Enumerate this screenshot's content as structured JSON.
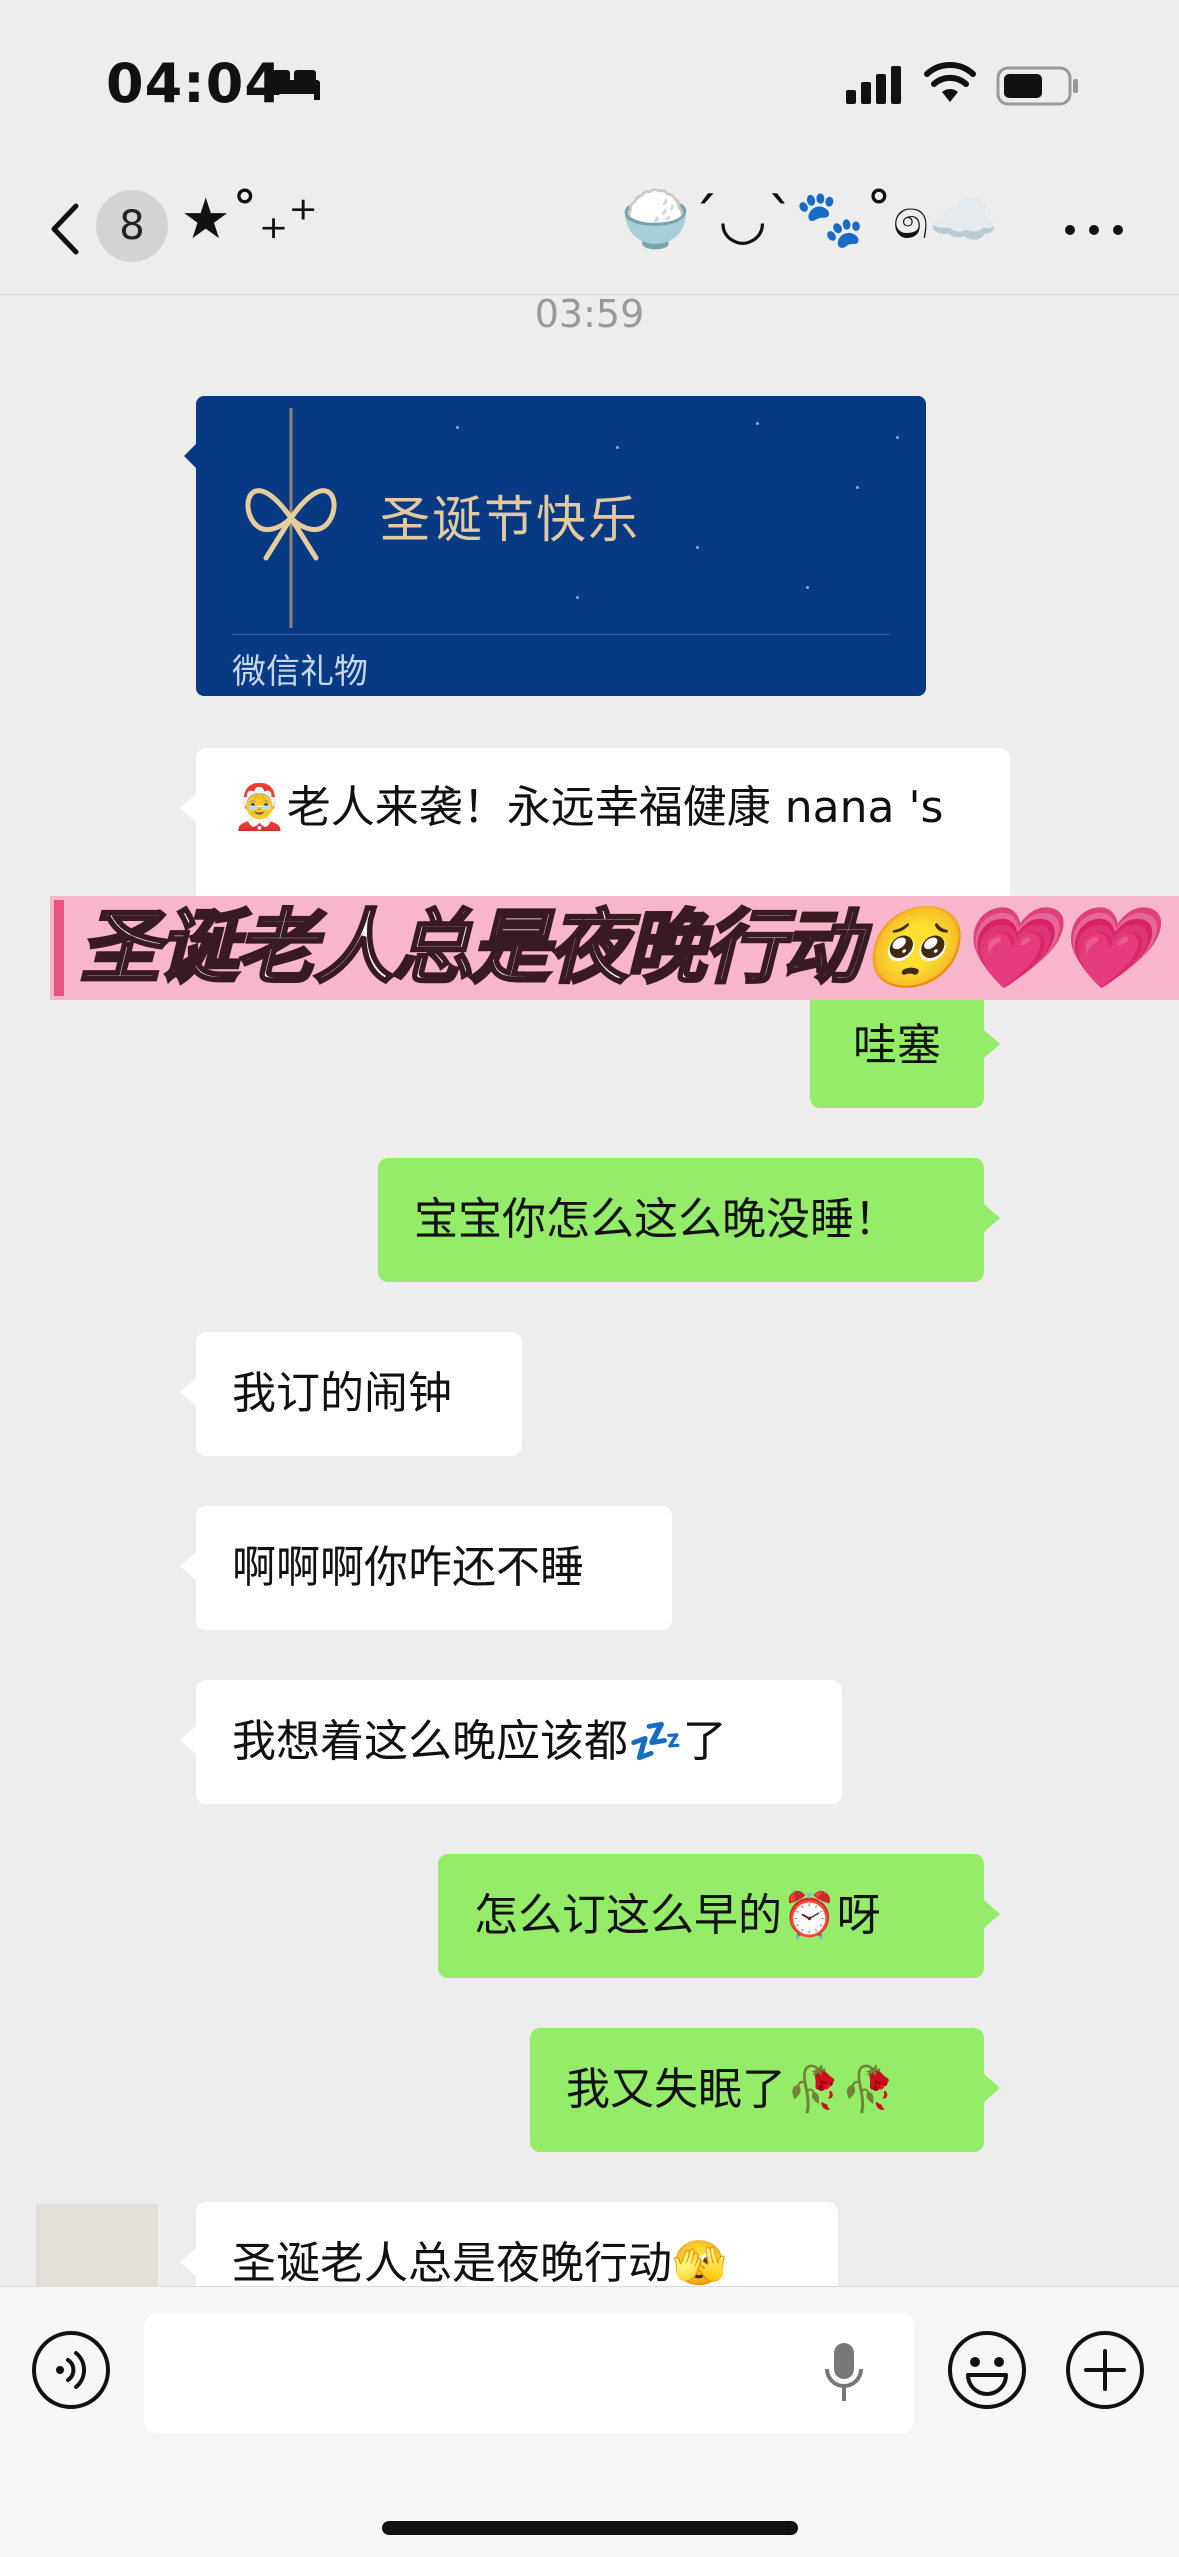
{
  "status_bar": {
    "time": "04:04"
  },
  "nav": {
    "unread_count": "8",
    "title": "★˚₊⁺                 🍚´◡`🐾˚෧☁️"
  },
  "chat": {
    "timestamp": "03:59",
    "gift_card": {
      "title": "圣诞节快乐",
      "footer": "微信礼物"
    },
    "messages": [
      {
        "side": "left",
        "text": "🤶老人来袭！永远幸福健康 nana 's"
      },
      {
        "side": "right",
        "text": "哇塞"
      },
      {
        "side": "right",
        "text": "宝宝你怎么这么晚没睡！"
      },
      {
        "side": "left",
        "text": "我订的闹钟"
      },
      {
        "side": "left",
        "text": "啊啊啊你咋还不睡"
      },
      {
        "side": "left",
        "text": "我想着这么晚应该都💤了"
      },
      {
        "side": "right",
        "text": "怎么订这么早的⏰呀"
      },
      {
        "side": "right",
        "text": "我又失眠了🥀🥀"
      },
      {
        "side": "left",
        "text": "圣诞老人总是夜晚行动🫣"
      }
    ]
  },
  "banner": {
    "text": "圣诞老人总是夜晚行动🥺💗💗"
  },
  "colors": {
    "outgoing_bubble": "#95ec69",
    "incoming_bubble": "#ffffff",
    "gift_card": "#073a82",
    "banner": "#f7b6cc"
  },
  "icons": [
    "bed-icon",
    "signal-icon",
    "wifi-icon",
    "battery-icon",
    "back-chevron-icon",
    "more-icon",
    "voice-icon",
    "mic-icon",
    "emoji-icon",
    "plus-icon"
  ]
}
